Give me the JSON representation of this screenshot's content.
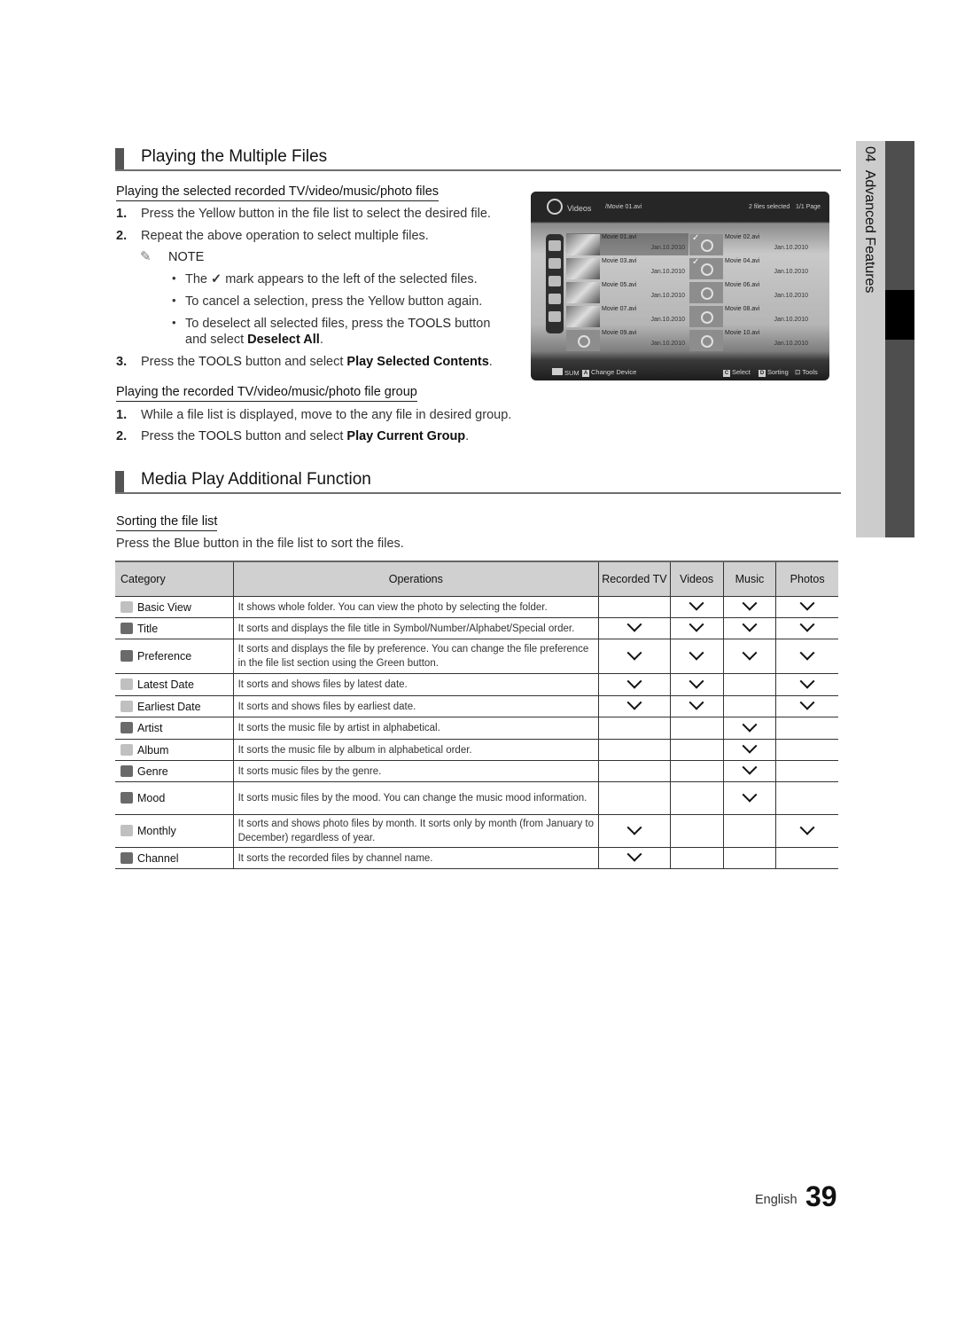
{
  "section1": {
    "title": "Playing the Multiple Files",
    "sub1": {
      "heading": "Playing the selected recorded TV/video/music/photo files",
      "steps": [
        {
          "num": "1.",
          "text": "Press the Yellow button in the file list to select the desired file."
        },
        {
          "num": "2.",
          "text": "Repeat the above operation to select multiple files."
        }
      ],
      "note_label": "NOTE",
      "note_icon": "pencil-icon",
      "bullets": [
        {
          "pre": "The ",
          "icon": "check-icon",
          "post": " mark appears to the left of the selected files."
        },
        {
          "text": "To cancel a selection, press the Yellow button again."
        },
        {
          "pre": "To deselect all selected files, press the ",
          "kw": "TOOLS",
          "post": " button",
          "line2_pre": "and select ",
          "line2_bold": "Deselect All",
          "line2_post": "."
        }
      ],
      "step3": {
        "num": "3.",
        "pre": "Press the ",
        "kw": "TOOLS",
        "mid": " button and select ",
        "bold": "Play Selected Contents",
        "post": "."
      }
    },
    "sub2": {
      "heading": "Playing the recorded TV/video/music/photo file group",
      "step1": {
        "num": "1.",
        "text": "While a file list is displayed, move to the any file in desired group."
      },
      "step2": {
        "num": "2.",
        "pre": "Press the ",
        "kw": "TOOLS",
        "mid": " button and select ",
        "bold": "Play Current Group",
        "post": "."
      }
    }
  },
  "tv_screen": {
    "category": "Videos",
    "path": "/Movie 01.avi",
    "selection_status": "2 files selected",
    "page": "1/1 Page",
    "files": [
      {
        "name": "Movie 01.avi",
        "date": "Jan.10.2010",
        "selected": false,
        "focused": true
      },
      {
        "name": "Movie 02.avi",
        "date": "Jan.10.2010",
        "selected": true
      },
      {
        "name": "Movie 03.avi",
        "date": "Jan.10.2010",
        "selected": false
      },
      {
        "name": "Movie 04.avi",
        "date": "Jan.10.2010",
        "selected": true
      },
      {
        "name": "Movie 05.avi",
        "date": "Jan.10.2010",
        "selected": false
      },
      {
        "name": "Movie 06.avi",
        "date": "Jan.10.2010",
        "selected": false
      },
      {
        "name": "Movie 07.avi",
        "date": "Jan.10.2010",
        "selected": false
      },
      {
        "name": "Movie 08.avi",
        "date": "Jan.10.2010",
        "selected": false
      },
      {
        "name": "Movie 09.avi",
        "date": "Jan.10.2010",
        "selected": false
      },
      {
        "name": "Movie 10.avi",
        "date": "Jan.10.2010",
        "selected": false
      }
    ],
    "footer": {
      "sum": "SUM",
      "change_device_key": "A",
      "change_device": "Change Device",
      "select_key": "C",
      "select": "Select",
      "sorting_key": "D",
      "sorting": "Sorting",
      "tools": "Tools"
    }
  },
  "section2": {
    "title": "Media Play Additional Function",
    "sub_heading": "Sorting the file list",
    "intro": "Press the Blue button in the file list to sort the files.",
    "table": {
      "headers": [
        "Category",
        "Operations",
        "Recorded TV",
        "Videos",
        "Music",
        "Photos"
      ],
      "rows": [
        {
          "category": "Basic View",
          "icon": "folder-icon",
          "operation": "It shows whole folder. You can view the photo by selecting the folder.",
          "recorded_tv": false,
          "videos": true,
          "music": true,
          "photos": true
        },
        {
          "category": "Title",
          "icon": "az-sort-icon",
          "operation": "It sorts and displays the file title in Symbol/Number/Alphabet/Special order.",
          "recorded_tv": true,
          "videos": true,
          "music": true,
          "photos": true
        },
        {
          "category": "Preference",
          "icon": "star-icon",
          "operation": "It sorts and displays the file by preference. You can change the file preference in the file list section using the Green button.",
          "recorded_tv": true,
          "videos": true,
          "music": true,
          "photos": true
        },
        {
          "category": "Latest Date",
          "icon": "calendar-30-icon",
          "operation": "It sorts and shows files by latest date.",
          "recorded_tv": true,
          "videos": true,
          "music": false,
          "photos": true
        },
        {
          "category": "Earliest Date",
          "icon": "calendar-1-icon",
          "operation": "It sorts and shows files by earliest date.",
          "recorded_tv": true,
          "videos": true,
          "music": false,
          "photos": true
        },
        {
          "category": "Artist",
          "icon": "artist-icon",
          "operation": "It sorts the music file by artist in alphabetical.",
          "recorded_tv": false,
          "videos": false,
          "music": true,
          "photos": false
        },
        {
          "category": "Album",
          "icon": "album-icon",
          "operation": "It sorts the music file by album in alphabetical order.",
          "recorded_tv": false,
          "videos": false,
          "music": true,
          "photos": false
        },
        {
          "category": "Genre",
          "icon": "guitar-icon",
          "operation": "It sorts music files by the genre.",
          "recorded_tv": false,
          "videos": false,
          "music": true,
          "photos": false
        },
        {
          "category": "Mood",
          "icon": "mood-icon",
          "operation": "It sorts music files by the mood. You can change the music mood information.",
          "recorded_tv": false,
          "videos": false,
          "music": true,
          "photos": false
        },
        {
          "category": "Monthly",
          "icon": "calendar-month-icon",
          "operation": "It sorts and shows photo files by month. It sorts only by month (from January to December) regardless of year.",
          "recorded_tv": true,
          "videos": false,
          "music": false,
          "photos": true
        },
        {
          "category": "Channel",
          "icon": "channel-icon",
          "operation": "It sorts the recorded files by channel name.",
          "recorded_tv": true,
          "videos": false,
          "music": false,
          "photos": false
        }
      ]
    }
  },
  "side_tab": {
    "chapter": "04",
    "label": "Advanced Features"
  },
  "footer": {
    "language": "English",
    "page_number": "39"
  }
}
